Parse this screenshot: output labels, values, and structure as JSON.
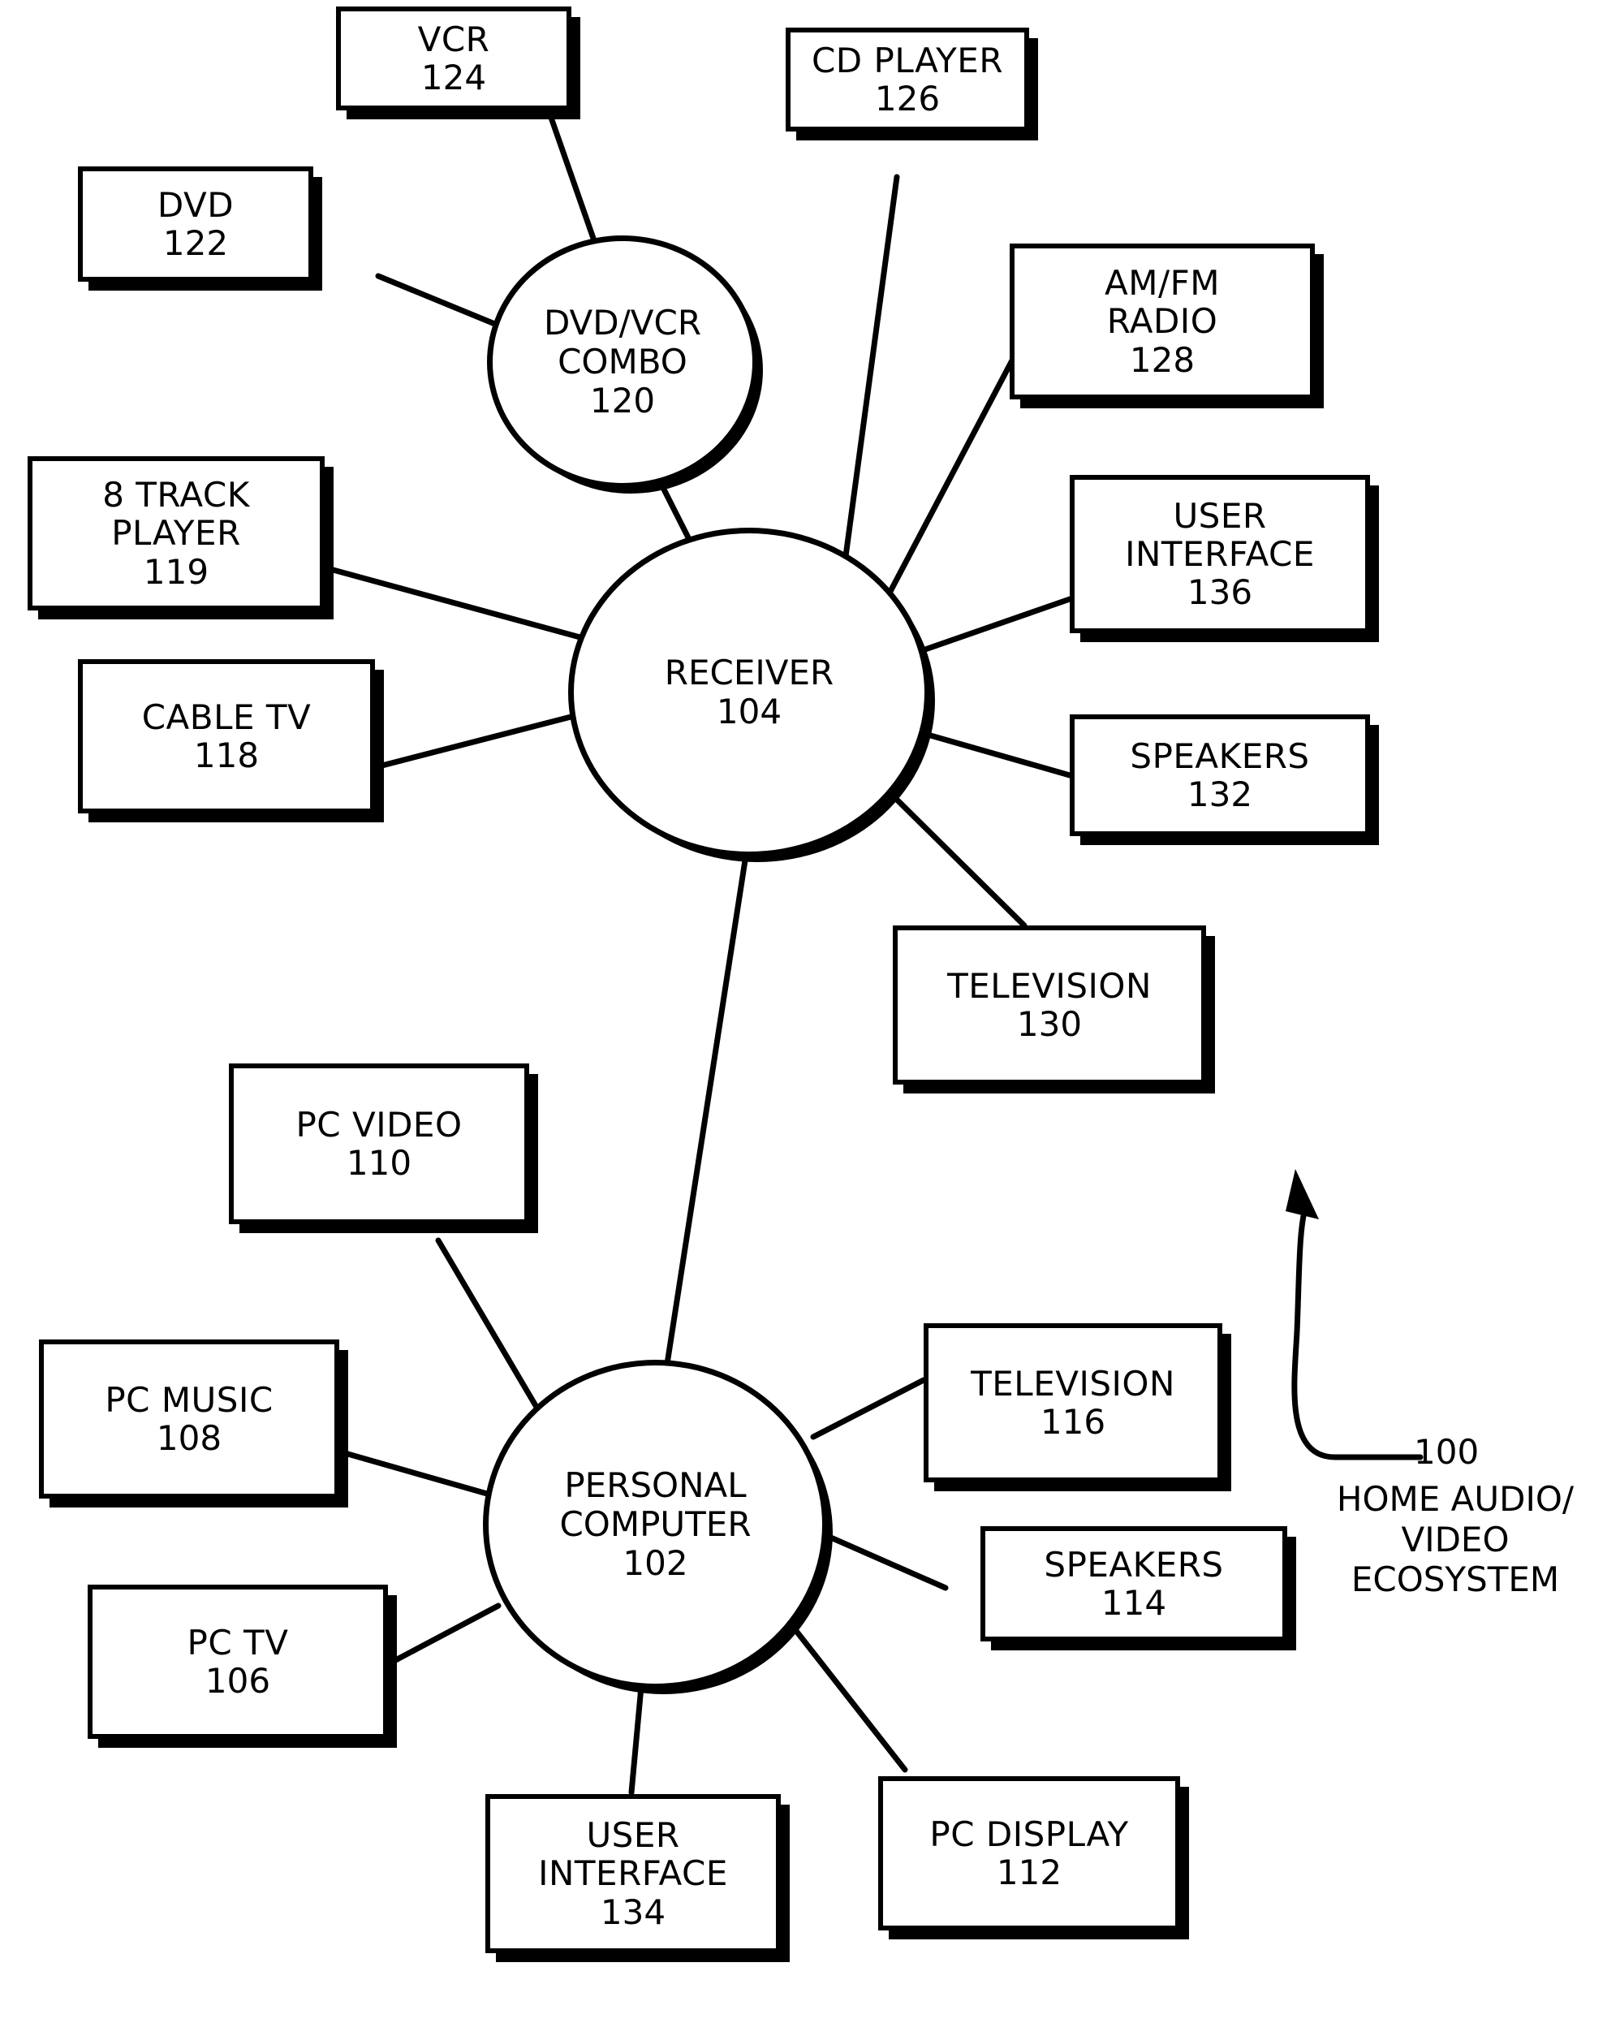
{
  "figure": {
    "kind": "patent-block-diagram",
    "background_color": "#ffffff",
    "line_color": "#000000"
  },
  "annotation": {
    "ref_number": "100",
    "caption": "HOME AUDIO/\nVIDEO\nECOSYSTEM",
    "arrow_icon": "curved-arrow-icon"
  },
  "hubs": {
    "receiver": {
      "label": "RECEIVER",
      "number": "104"
    },
    "pc": {
      "label_line1": "PERSONAL",
      "label_line2": "COMPUTER",
      "number": "102"
    },
    "dvdvcr": {
      "label_line1": "DVD/VCR",
      "label_line2": "COMBO",
      "number": "120"
    }
  },
  "nodes": [
    {
      "id": "vcr",
      "label": "VCR",
      "number": "124"
    },
    {
      "id": "cd-player",
      "label": "CD PLAYER",
      "number": "126"
    },
    {
      "id": "dvd",
      "label": "DVD",
      "number": "122"
    },
    {
      "id": "am-fm-radio",
      "label_line1": "AM/FM",
      "label_line2": "RADIO",
      "number": "128"
    },
    {
      "id": "user-interface-136",
      "label_line1": "USER",
      "label_line2": "INTERFACE",
      "number": "136"
    },
    {
      "id": "eight-track",
      "label_line1": "8 TRACK",
      "label_line2": "PLAYER",
      "number": "119"
    },
    {
      "id": "speakers-132",
      "label": "SPEAKERS",
      "number": "132"
    },
    {
      "id": "cable-tv",
      "label": "CABLE TV",
      "number": "118"
    },
    {
      "id": "television-130",
      "label": "TELEVISION",
      "number": "130"
    },
    {
      "id": "pc-video",
      "label": "PC VIDEO",
      "number": "110"
    },
    {
      "id": "television-116",
      "label": "TELEVISION",
      "number": "116"
    },
    {
      "id": "pc-music",
      "label": "PC MUSIC",
      "number": "108"
    },
    {
      "id": "speakers-114",
      "label": "SPEAKERS",
      "number": "114"
    },
    {
      "id": "pc-tv",
      "label": "PC TV",
      "number": "106"
    },
    {
      "id": "pc-display",
      "label": "PC DISPLAY",
      "number": "112"
    },
    {
      "id": "user-interface-134",
      "label_line1": "USER",
      "label_line2": "INTERFACE",
      "number": "134"
    }
  ],
  "boxes": {
    "vcr": {
      "label": "VCR",
      "number": "124"
    },
    "cd_player": {
      "label": "CD PLAYER",
      "number": "126"
    },
    "dvd": {
      "label": "DVD",
      "number": "122"
    },
    "am_fm_radio": {
      "line1": "AM/FM",
      "line2": "RADIO",
      "number": "128"
    },
    "user_interface_136": {
      "line1": "USER",
      "line2": "INTERFACE",
      "number": "136"
    },
    "eight_track": {
      "line1": "8 TRACK",
      "line2": "PLAYER",
      "number": "119"
    },
    "speakers_132": {
      "label": "SPEAKERS",
      "number": "132"
    },
    "cable_tv": {
      "label": "CABLE TV",
      "number": "118"
    },
    "television_130": {
      "label": "TELEVISION",
      "number": "130"
    },
    "pc_video": {
      "label": "PC VIDEO",
      "number": "110"
    },
    "television_116": {
      "label": "TELEVISION",
      "number": "116"
    },
    "pc_music": {
      "label": "PC MUSIC",
      "number": "108"
    },
    "speakers_114": {
      "label": "SPEAKERS",
      "number": "114"
    },
    "pc_tv": {
      "label": "PC TV",
      "number": "106"
    },
    "pc_display": {
      "label": "PC DISPLAY",
      "number": "112"
    },
    "user_interface_134": {
      "line1": "USER",
      "line2": "INTERFACE",
      "number": "134"
    }
  },
  "connections": [
    {
      "from": "dvd-vcr-combo-120",
      "to": "vcr-124"
    },
    {
      "from": "dvd-vcr-combo-120",
      "to": "dvd-122"
    },
    {
      "from": "dvd-vcr-combo-120",
      "to": "receiver-104"
    },
    {
      "from": "receiver-104",
      "to": "cd-player-126"
    },
    {
      "from": "receiver-104",
      "to": "am-fm-radio-128"
    },
    {
      "from": "receiver-104",
      "to": "user-interface-136"
    },
    {
      "from": "receiver-104",
      "to": "speakers-132"
    },
    {
      "from": "receiver-104",
      "to": "television-130"
    },
    {
      "from": "receiver-104",
      "to": "eight-track-player-119"
    },
    {
      "from": "receiver-104",
      "to": "cable-tv-118"
    },
    {
      "from": "receiver-104",
      "to": "personal-computer-102"
    },
    {
      "from": "personal-computer-102",
      "to": "pc-video-110"
    },
    {
      "from": "personal-computer-102",
      "to": "pc-music-108"
    },
    {
      "from": "personal-computer-102",
      "to": "pc-tv-106"
    },
    {
      "from": "personal-computer-102",
      "to": "television-116"
    },
    {
      "from": "personal-computer-102",
      "to": "speakers-114"
    },
    {
      "from": "personal-computer-102",
      "to": "pc-display-112"
    },
    {
      "from": "personal-computer-102",
      "to": "user-interface-134"
    }
  ]
}
